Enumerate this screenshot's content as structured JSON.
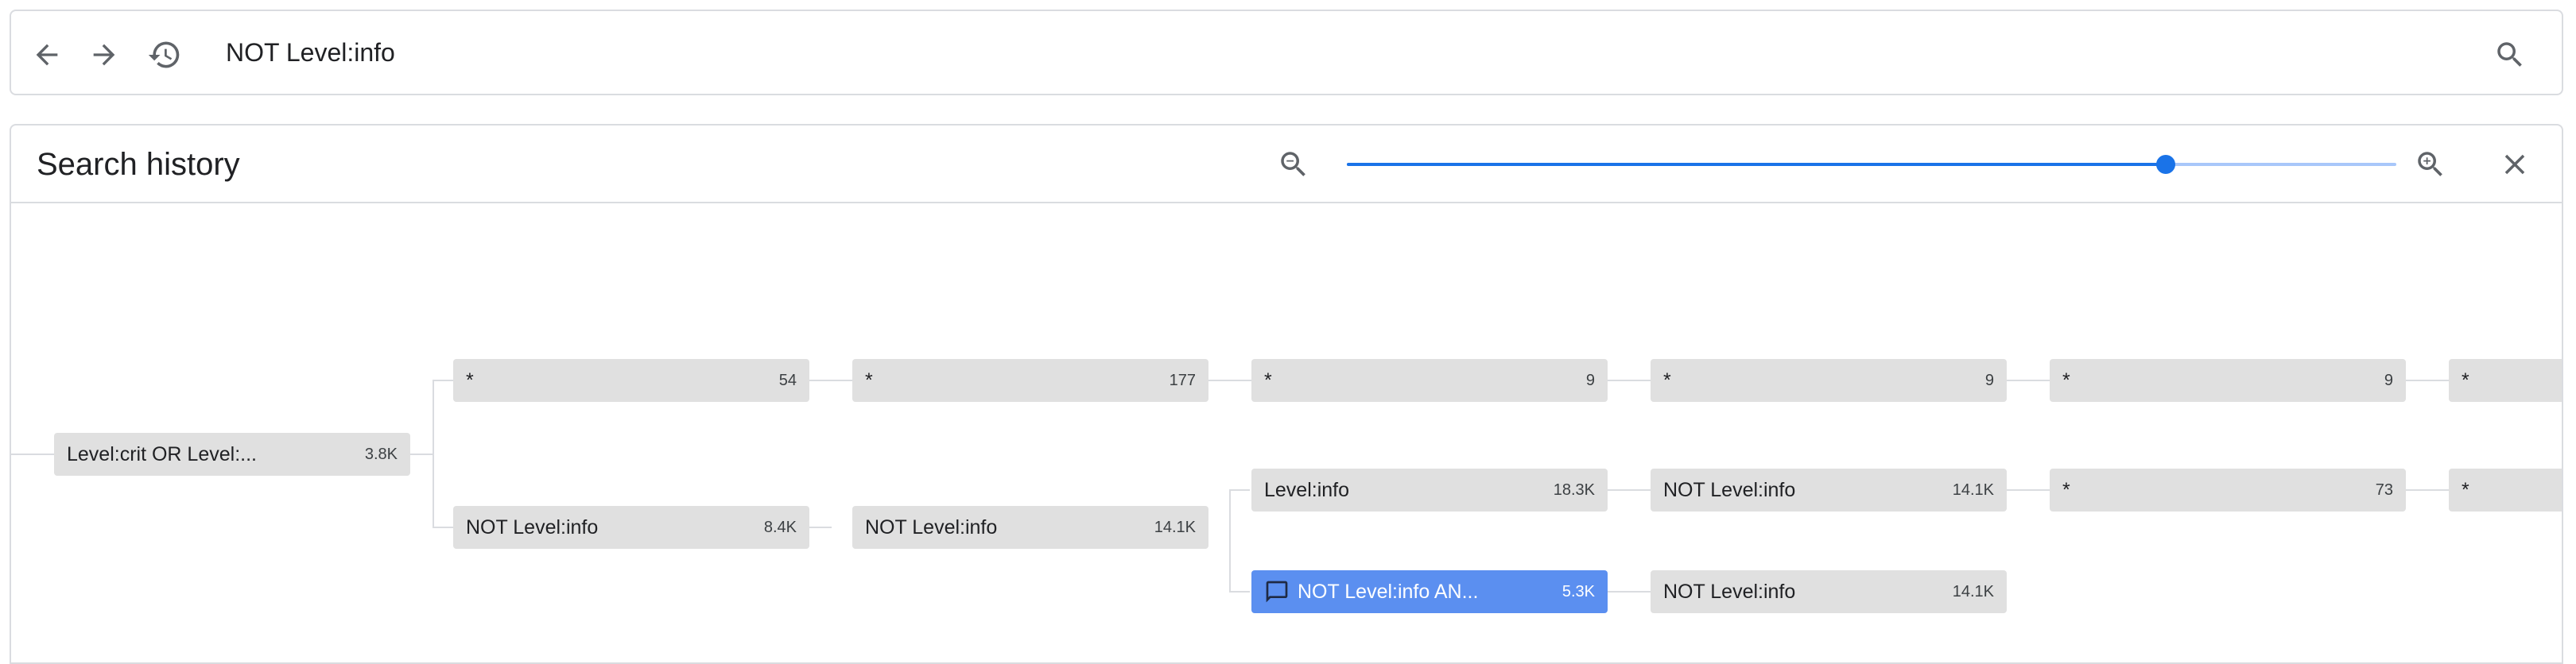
{
  "search": {
    "query": "NOT Level:info"
  },
  "history_panel": {
    "title": "Search history",
    "zoom_level": 0.78
  },
  "nodes": {
    "root": {
      "label": "Level:crit OR Level:...",
      "count": "3.8K"
    },
    "a1": {
      "label": "*",
      "count": "54"
    },
    "a2": {
      "label": "*",
      "count": "177"
    },
    "a3": {
      "label": "*",
      "count": "9"
    },
    "a4": {
      "label": "*",
      "count": "9"
    },
    "a5": {
      "label": "*",
      "count": "9"
    },
    "a6": {
      "label": "*",
      "count": ""
    },
    "b1": {
      "label": "NOT Level:info",
      "count": "8.4K"
    },
    "b2": {
      "label": "NOT Level:info",
      "count": "14.1K"
    },
    "c3": {
      "label": "Level:info",
      "count": "18.3K"
    },
    "c4": {
      "label": "NOT Level:info",
      "count": "14.1K"
    },
    "c5": {
      "label": "*",
      "count": "73"
    },
    "c6": {
      "label": "*",
      "count": ""
    },
    "d3": {
      "label": "NOT Level:info AN...",
      "count": "5.3K"
    },
    "d4": {
      "label": "NOT Level:info",
      "count": "14.1K"
    }
  },
  "colors": {
    "accent": "#1a73e8",
    "selected_node": "#5b8ff0",
    "node_bg": "#e0e0e0",
    "border": "#dadce0"
  },
  "icons": {
    "back": "arrow-back-icon",
    "forward": "arrow-forward-icon",
    "history": "history-icon",
    "search": "search-icon",
    "zoom_out": "zoom-out-icon",
    "zoom_in": "zoom-in-icon",
    "close": "close-icon",
    "comment": "comment-icon"
  }
}
